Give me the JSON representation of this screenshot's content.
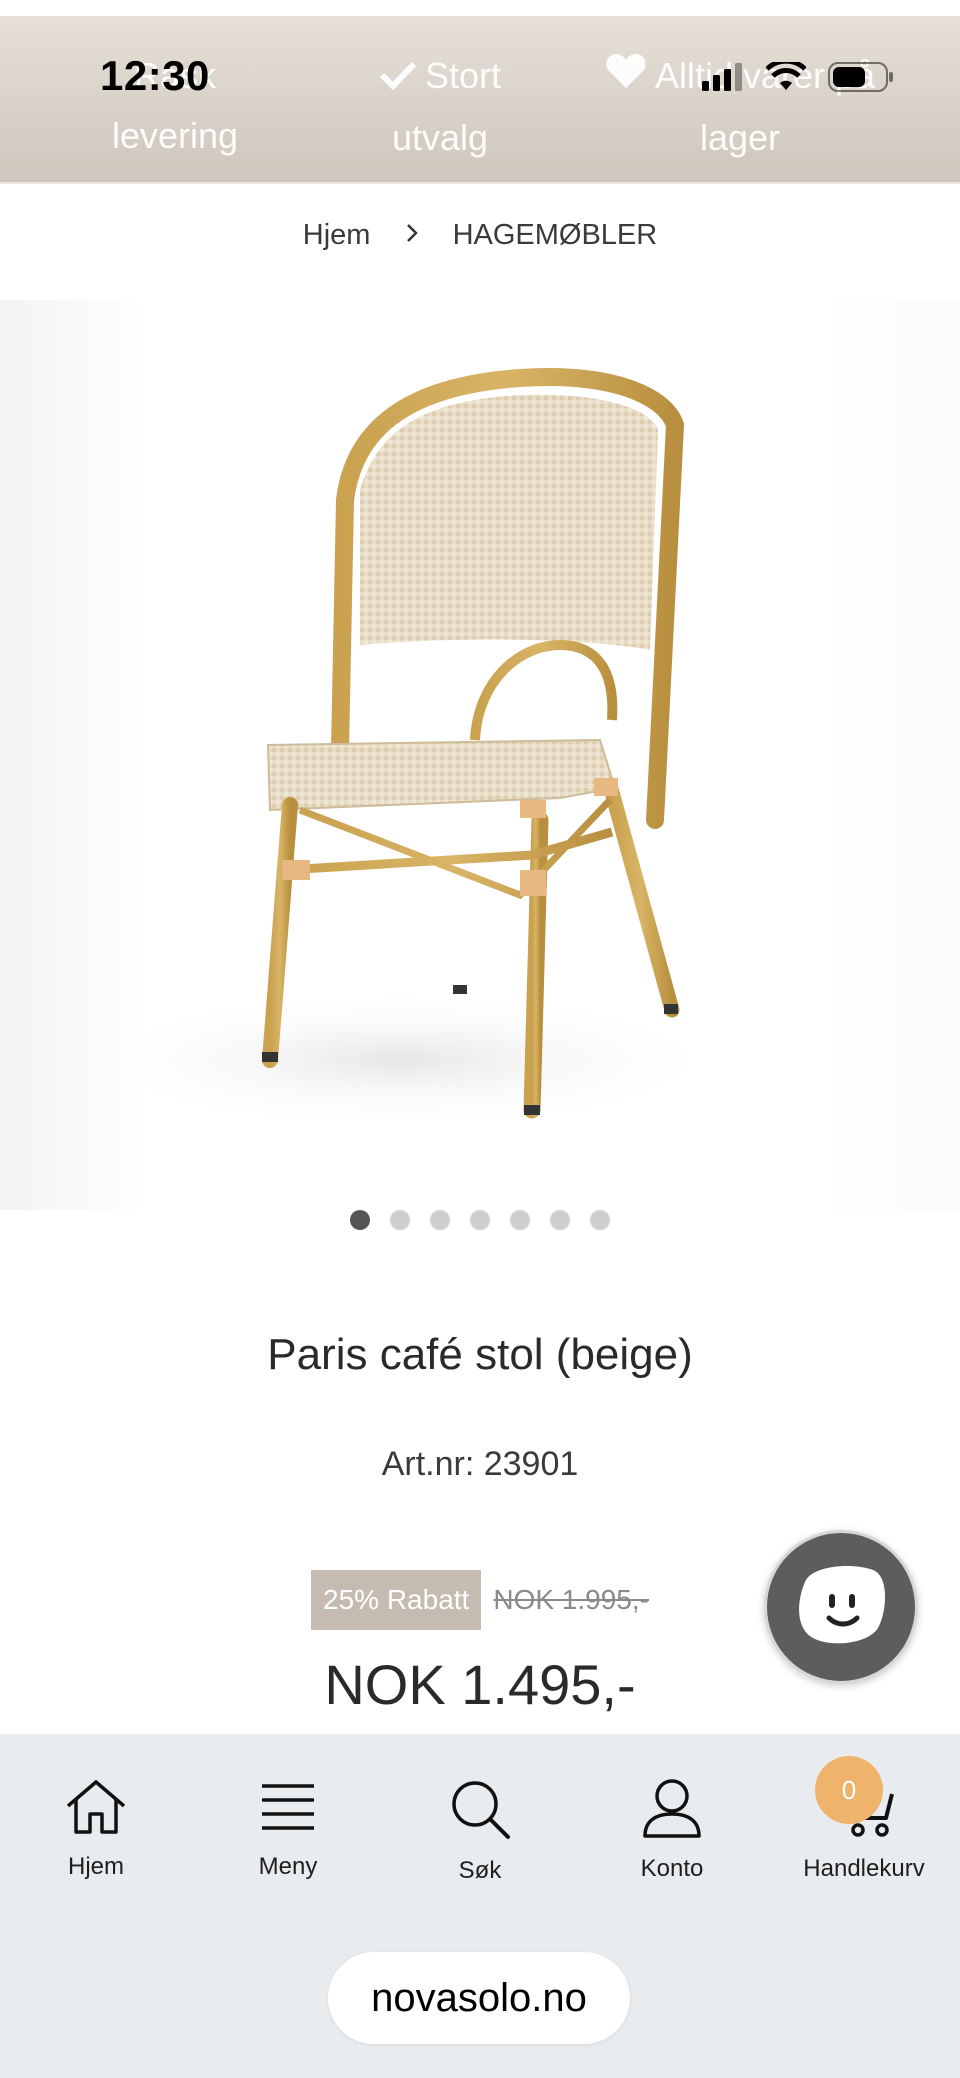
{
  "status_bar": {
    "time": "12:30"
  },
  "usp_bar": {
    "items": [
      {
        "icon": "truck-icon",
        "text": "Rask levering"
      },
      {
        "icon": "check-icon",
        "text": "Stort utvalg"
      },
      {
        "icon": "heart-icon",
        "text": "Alltid varer på lager"
      }
    ]
  },
  "breadcrumb": {
    "home": "Hjem",
    "category": "HAGEMØBLER"
  },
  "gallery": {
    "image": "chair-photo",
    "slide_count": 7,
    "active_slide": 1
  },
  "product": {
    "title": "Paris café stol (beige)",
    "art_nr": "Art.nr: 23901",
    "discount_badge": "25% Rabatt",
    "old_price": "NOK 1.995,-",
    "price": "NOK 1.495,-"
  },
  "chat": {
    "icon": "chat-smiley-icon"
  },
  "bottom_nav": {
    "items": [
      {
        "icon": "home-icon",
        "label": "Hjem"
      },
      {
        "icon": "menu-icon",
        "label": "Meny"
      },
      {
        "icon": "search-icon",
        "label": "Søk"
      },
      {
        "icon": "account-icon",
        "label": "Konto"
      },
      {
        "icon": "cart-icon",
        "label": "Handlekurv"
      }
    ],
    "cart_count": "0"
  },
  "browser": {
    "url": "novasolo.no"
  },
  "colors": {
    "accent": "#efb36b",
    "badge": "#c6bbb1",
    "chat": "#5d5d5d"
  }
}
